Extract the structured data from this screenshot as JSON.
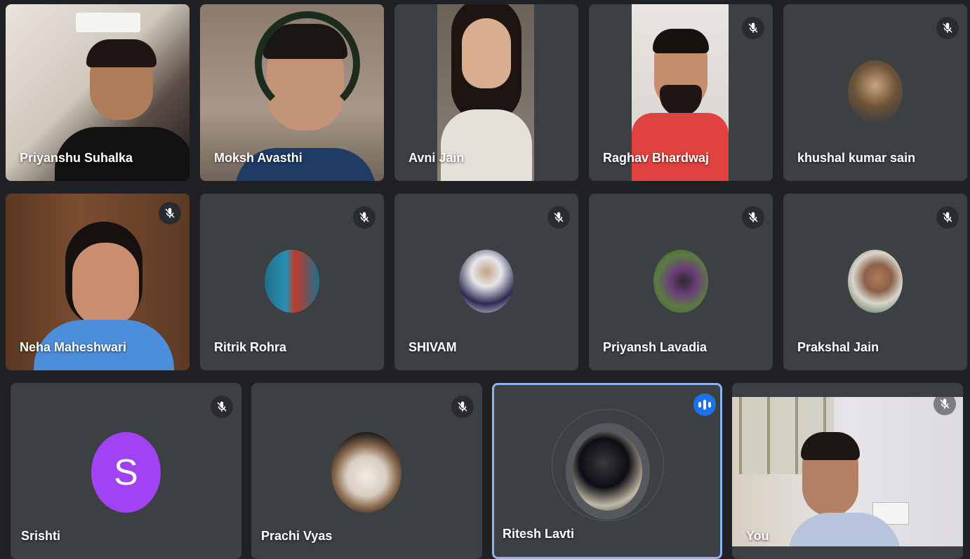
{
  "participants": [
    {
      "name": "Priyanshu Suhalka"
    },
    {
      "name": "Moksh Avasthi"
    },
    {
      "name": "Avni Jain"
    },
    {
      "name": "Raghav Bhardwaj"
    },
    {
      "name": "khushal kumar sain"
    },
    {
      "name": "Neha Maheshwari"
    },
    {
      "name": "Ritrik Rohra"
    },
    {
      "name": "SHIVAM"
    },
    {
      "name": "Priyansh Lavadia"
    },
    {
      "name": "Prakshal Jain"
    },
    {
      "name": "Srishti",
      "initial": "S"
    },
    {
      "name": "Prachi Vyas"
    },
    {
      "name": "Ritesh Lavti"
    },
    {
      "name": "You"
    }
  ],
  "colors": {
    "background": "#202124",
    "tile": "#3c4043",
    "active_border": "#8ab4f8",
    "speaking": "#1a73e8",
    "initial_avatar": "#a142f4"
  },
  "icons": {
    "muted": "mic-off-icon",
    "speaking": "speaking-indicator-icon"
  }
}
